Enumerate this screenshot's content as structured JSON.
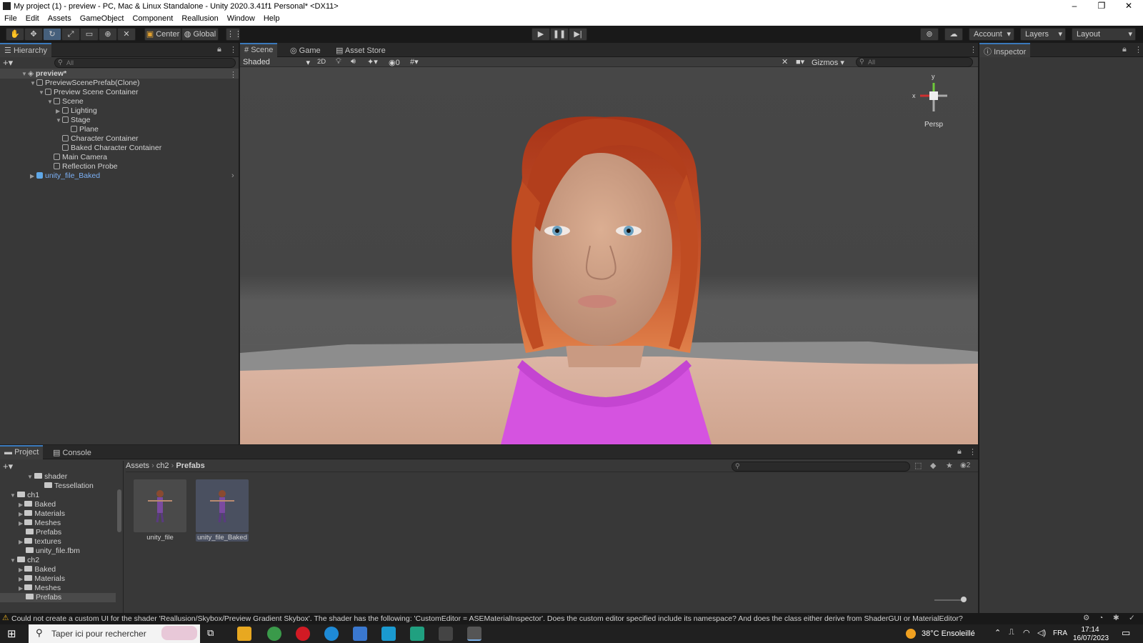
{
  "window": {
    "title": "My project (1) - preview - PC, Mac & Linux Standalone - Unity 2020.3.41f1 Personal* <DX11>",
    "min": "–",
    "max": "❐",
    "close": "✕"
  },
  "menu": [
    "File",
    "Edit",
    "Assets",
    "GameObject",
    "Component",
    "Reallusion",
    "Window",
    "Help"
  ],
  "toolbar": {
    "pivot": "Center",
    "space": "Global",
    "account": "Account",
    "layers": "Layers",
    "layout": "Layout"
  },
  "hierarchy": {
    "tab": "Hierarchy",
    "search_placeholder": "All",
    "rows": [
      {
        "label": "preview*"
      },
      {
        "label": "PreviewScenePrefab(Clone)"
      },
      {
        "label": "Preview Scene Container"
      },
      {
        "label": "Scene"
      },
      {
        "label": "Lighting"
      },
      {
        "label": "Stage"
      },
      {
        "label": "Plane"
      },
      {
        "label": "Character Container"
      },
      {
        "label": "Baked Character Container"
      },
      {
        "label": "Main Camera"
      },
      {
        "label": "Reflection Probe"
      },
      {
        "label": "unity_file_Baked"
      }
    ]
  },
  "scene": {
    "tabs": [
      "Scene",
      "Game",
      "Asset Store"
    ],
    "shading": "Shaded",
    "mode2d": "2D",
    "hidden_count": "0",
    "gizmos": "Gizmos",
    "search_placeholder": "All",
    "persp": "Persp",
    "axis_y": "y",
    "axis_x": "x"
  },
  "inspector": {
    "tab": "Inspector"
  },
  "project": {
    "tabs": [
      "Project",
      "Console"
    ],
    "tree": [
      {
        "label": "shader"
      },
      {
        "label": "Tessellation"
      },
      {
        "label": "ch1"
      },
      {
        "label": "Baked"
      },
      {
        "label": "Materials"
      },
      {
        "label": "Meshes"
      },
      {
        "label": "Prefabs"
      },
      {
        "label": "textures"
      },
      {
        "label": "unity_file.fbm"
      },
      {
        "label": "ch2"
      },
      {
        "label": "Baked"
      },
      {
        "label": "Materials"
      },
      {
        "label": "Meshes"
      },
      {
        "label": "Prefabs"
      }
    ],
    "breadcrumb": [
      "Assets",
      "ch2",
      "Prefabs"
    ],
    "assets": [
      {
        "label": "unity_file"
      },
      {
        "label": "unity_file_Baked"
      }
    ],
    "hidden_count": "2"
  },
  "status": {
    "message": "Could not create a custom UI for the shader 'Reallusion/Skybox/Preview Gradient Skybox'. The shader has the following: 'CustomEditor = ASEMaterialInspector'. Does the custom editor specified include its namespace? And does the class either derive from ShaderGUI or MaterialEditor?"
  },
  "taskbar": {
    "search_placeholder": "Taper ici pour rechercher",
    "weather": "38°C  Ensoleillé",
    "lang": "FRA",
    "time": "17:14",
    "date": "16/07/2023"
  },
  "colors": {
    "accent": "#3a79bb",
    "hair": "#b8401c",
    "top": "#d553e0",
    "skin": "#d9a68a"
  }
}
